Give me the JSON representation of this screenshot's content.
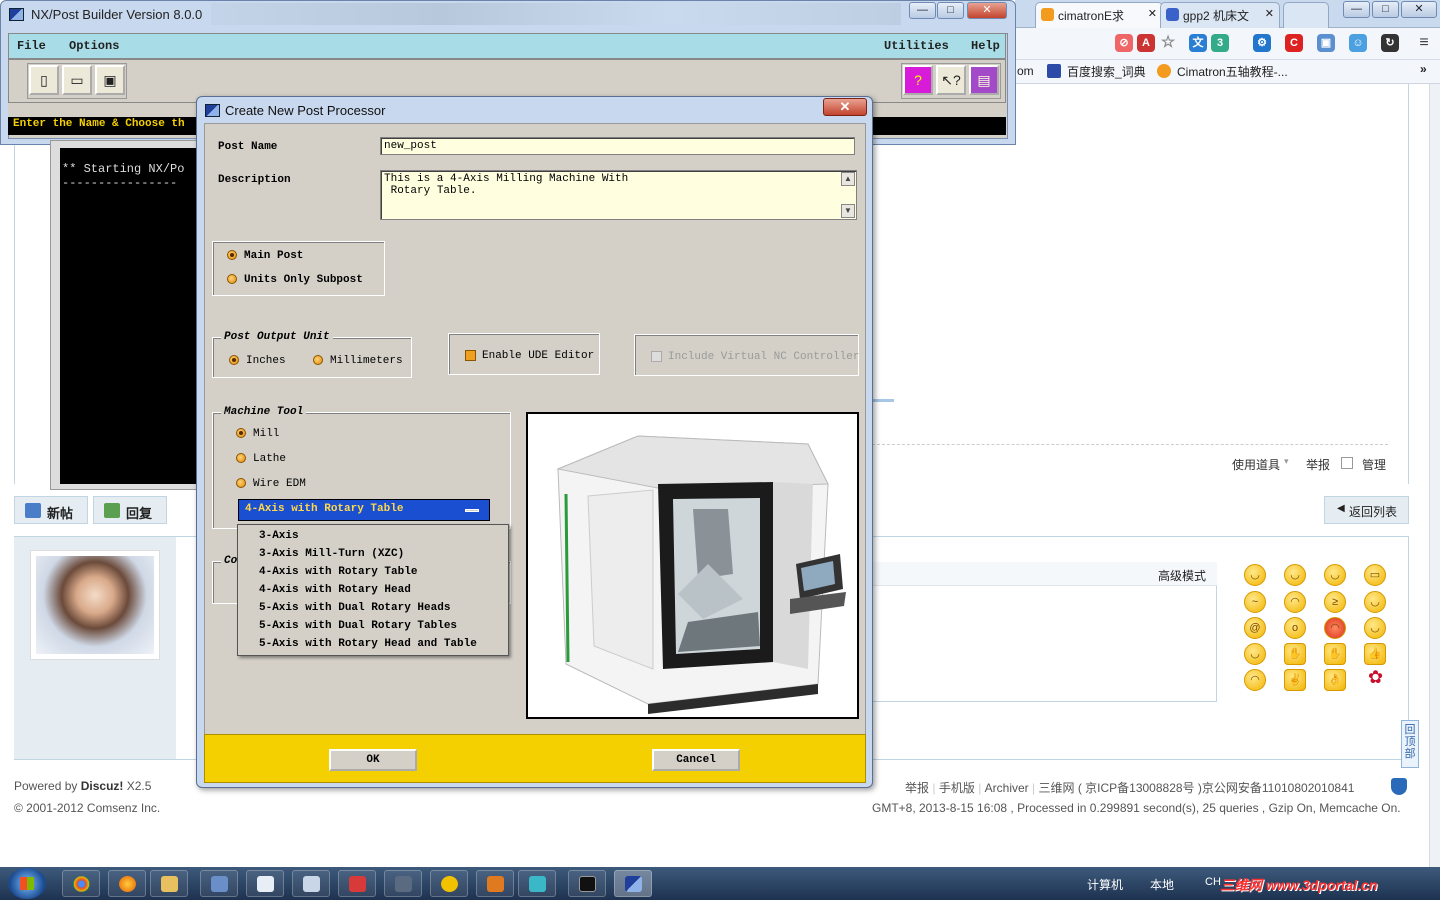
{
  "browser": {
    "tabs": [
      {
        "label": "cimatronE求"
      },
      {
        "label": "gpp2 机床文"
      }
    ],
    "url_fragment": "om",
    "bookmarks": [
      "百度搜索_词典",
      "Cimatron五轴教程-..."
    ],
    "bookmarks_more": "»"
  },
  "forum": {
    "tools_label": "使用道具",
    "report_label": "举报",
    "manage_label": "管理",
    "new_post_button": "新帖",
    "reply_button": "回复",
    "back_to_list": "返回列表",
    "advanced_mode": "高级模式",
    "back_to_top": "回顶部",
    "footer_powered_prefix": "Powered by",
    "footer_powered_brand": "Discuz!",
    "footer_powered_version": "X2.5",
    "footer_copyright": "© 2001-2012 Comsenz Inc.",
    "footer_links": [
      "举报",
      "|",
      "手机版",
      "|",
      "Archiver",
      "|"
    ],
    "footer_icp": "三维网 ( 京ICP备13008828号 )京公网安备11010802010841",
    "footer_stats": "GMT+8, 2013-8-15 16:08 , Processed in 0.299891 second(s), 25 queries , Gzip On, Memcache On."
  },
  "postbuilder": {
    "title": "NX/Post Builder Version 8.0.0",
    "menu": {
      "file": "File",
      "options": "Options",
      "utilities": "Utilities",
      "help": "Help"
    },
    "status": "Enter the Name & Choose th",
    "console_line": "** Starting NX/Po",
    "console_rule": "----------------"
  },
  "dialog": {
    "title": "Create New Post Processor",
    "close_symbol": "✕",
    "post_name_label": "Post Name",
    "post_name_value": "new_post",
    "description_label": "Description",
    "description_value": "This is a 4-Axis Milling Machine With\n Rotary Table.",
    "post_type_options": [
      "Main Post",
      "Units Only Subpost"
    ],
    "output_unit_label": "Post Output Unit",
    "unit_options": [
      "Inches",
      "Millimeters"
    ],
    "enable_ude_label": "Enable UDE Editor",
    "virtual_nc_label": "Include Virtual NC Controller",
    "machine_tool_label": "Machine Tool",
    "machine_options": [
      "Mill",
      "Lathe",
      "Wire EDM"
    ],
    "dropdown_selected": "4-Axis with Rotary Table",
    "dropdown_items": [
      "3-Axis",
      "3-Axis Mill-Turn (XZC)",
      "4-Axis with Rotary Table",
      "4-Axis with Rotary Head",
      "5-Axis with Dual Rotary Heads",
      "5-Axis with Dual Rotary Tables",
      "5-Axis with Rotary Head and Table"
    ],
    "controller_label_partial": "Co",
    "ok_button": "OK",
    "cancel_button": "Cancel"
  },
  "taskbar": {
    "computer_label": "计算机",
    "local_label": "本地",
    "lang": "CH",
    "watermark": "三维网 www.3dportal.cn"
  },
  "colors": {
    "dialog_frame": "#c8d8ee",
    "input_bg": "#ffffe0",
    "dropdown_bg": "#1a4fd1",
    "button_bar": "#f4d000"
  }
}
